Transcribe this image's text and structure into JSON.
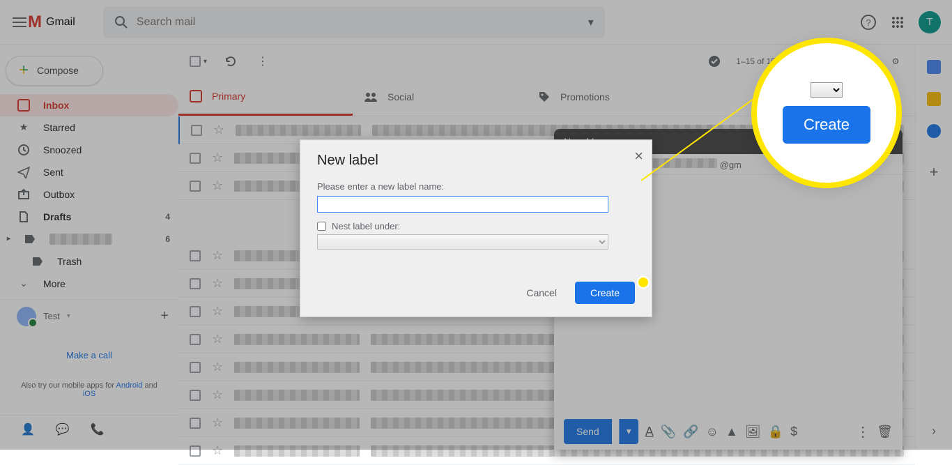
{
  "header": {
    "product": "Gmail",
    "search_placeholder": "Search mail",
    "avatar_initial": "T"
  },
  "compose_button": "Compose",
  "sidebar": {
    "items": [
      {
        "label": "Inbox"
      },
      {
        "label": "Starred"
      },
      {
        "label": "Snoozed"
      },
      {
        "label": "Sent"
      },
      {
        "label": "Outbox"
      },
      {
        "label": "Drafts",
        "count": "4"
      },
      {
        "label": "",
        "count": "6"
      },
      {
        "label": "Trash"
      },
      {
        "label": "More"
      }
    ],
    "user": "Test",
    "call_link": "Make a call",
    "apps_text_1": "Also try our mobile apps for ",
    "apps_text_2": " and ",
    "android": "Android",
    "ios": "iOS"
  },
  "toolbar": {
    "page_info": "1–15 of 15"
  },
  "tabs": {
    "primary": "Primary",
    "social": "Social",
    "promotions": "Promotions"
  },
  "compose_card": {
    "title": "New Message",
    "to_sufix": "@gm",
    "send": "Send"
  },
  "modal": {
    "title": "New label",
    "prompt": "Please enter a new label name:",
    "nest_label": "Nest label under:",
    "cancel": "Cancel",
    "create": "Create"
  },
  "callout": {
    "create": "Create"
  }
}
